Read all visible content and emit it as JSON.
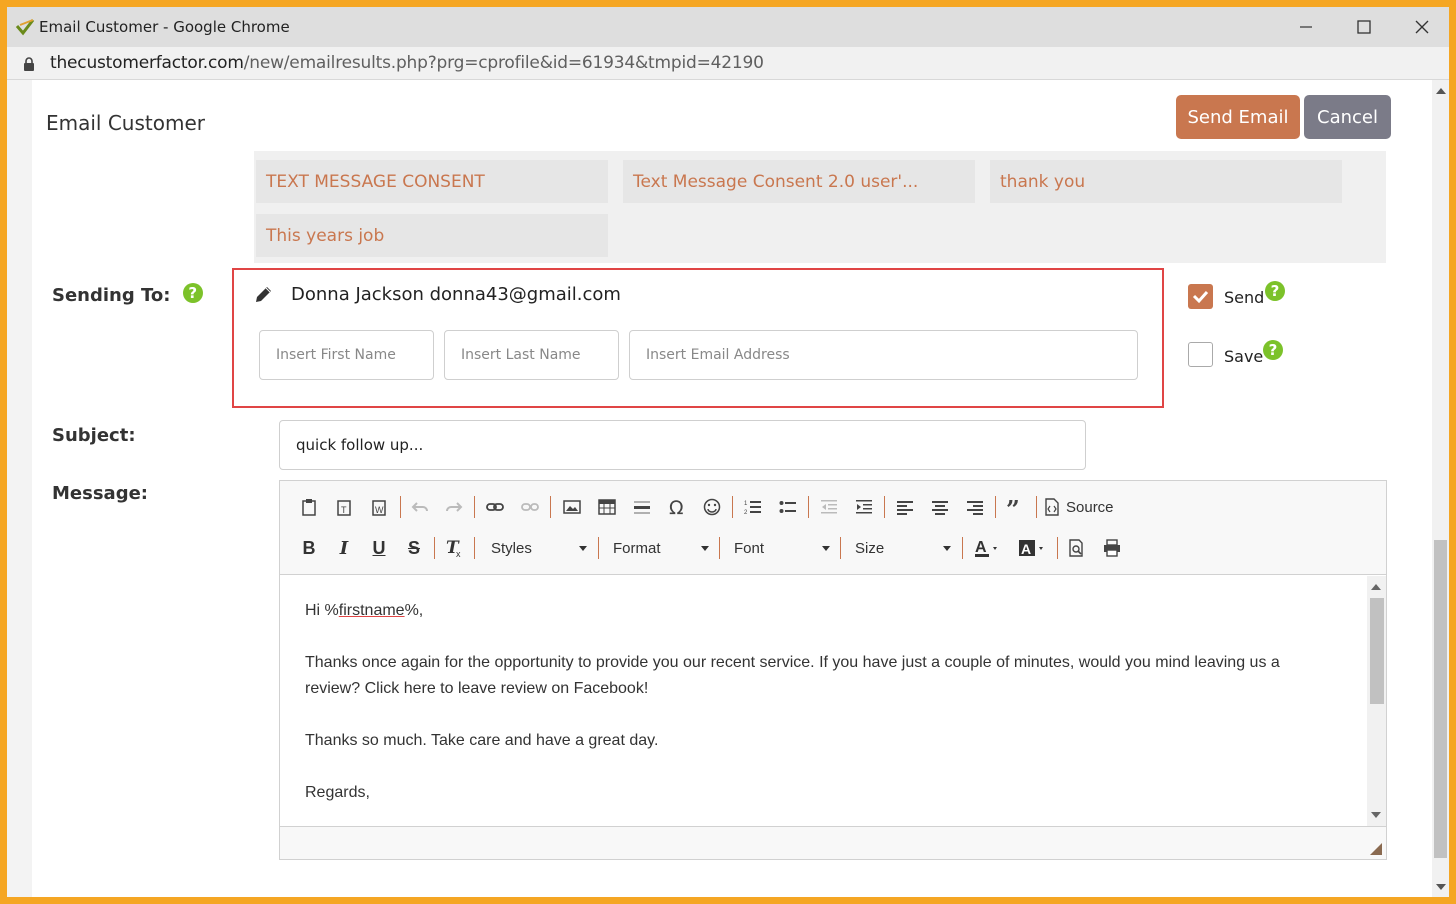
{
  "browser": {
    "title": "Email Customer - Google Chrome",
    "url_host": "thecustomerfactor.com",
    "url_path": "/new/emailresults.php?prg=cprofile&id=61934&tmpid=42190"
  },
  "header": {
    "title": "Email Customer",
    "send_label": "Send Email",
    "cancel_label": "Cancel"
  },
  "templates": [
    "TEXT MESSAGE CONSENT",
    "Text Message Consent 2.0 user'...",
    "thank you",
    "This years job"
  ],
  "sending_to": {
    "label": "Sending To:",
    "help": "?",
    "recipient": "Donna Jackson donna43@gmail.com",
    "first_name_placeholder": "Insert First Name",
    "last_name_placeholder": "Insert Last Name",
    "email_placeholder": "Insert Email Address"
  },
  "options": {
    "send_label": "Send",
    "send_checked": true,
    "save_label": "Save",
    "save_checked": false
  },
  "subject": {
    "label": "Subject:",
    "value": "quick follow up..."
  },
  "message": {
    "label": "Message:",
    "toolbar": {
      "source_label": "Source",
      "styles_label": "Styles",
      "format_label": "Format",
      "font_label": "Font",
      "size_label": "Size"
    },
    "greeting_prefix": "Hi %",
    "greeting_token": "firstname",
    "greeting_suffix": "%,",
    "paragraph1": "Thanks once again for the opportunity to provide you our recent service. If you have just a couple of minutes, would you mind leaving us a review? Click here to leave review on Facebook!",
    "paragraph2": "Thanks so much. Take care and have a great day.",
    "paragraph3": "Regards,"
  },
  "colors": {
    "accent": "#c9774f",
    "cancel": "#7b7b88",
    "help": "#7cc22a",
    "highlight_border": "#e04545"
  }
}
